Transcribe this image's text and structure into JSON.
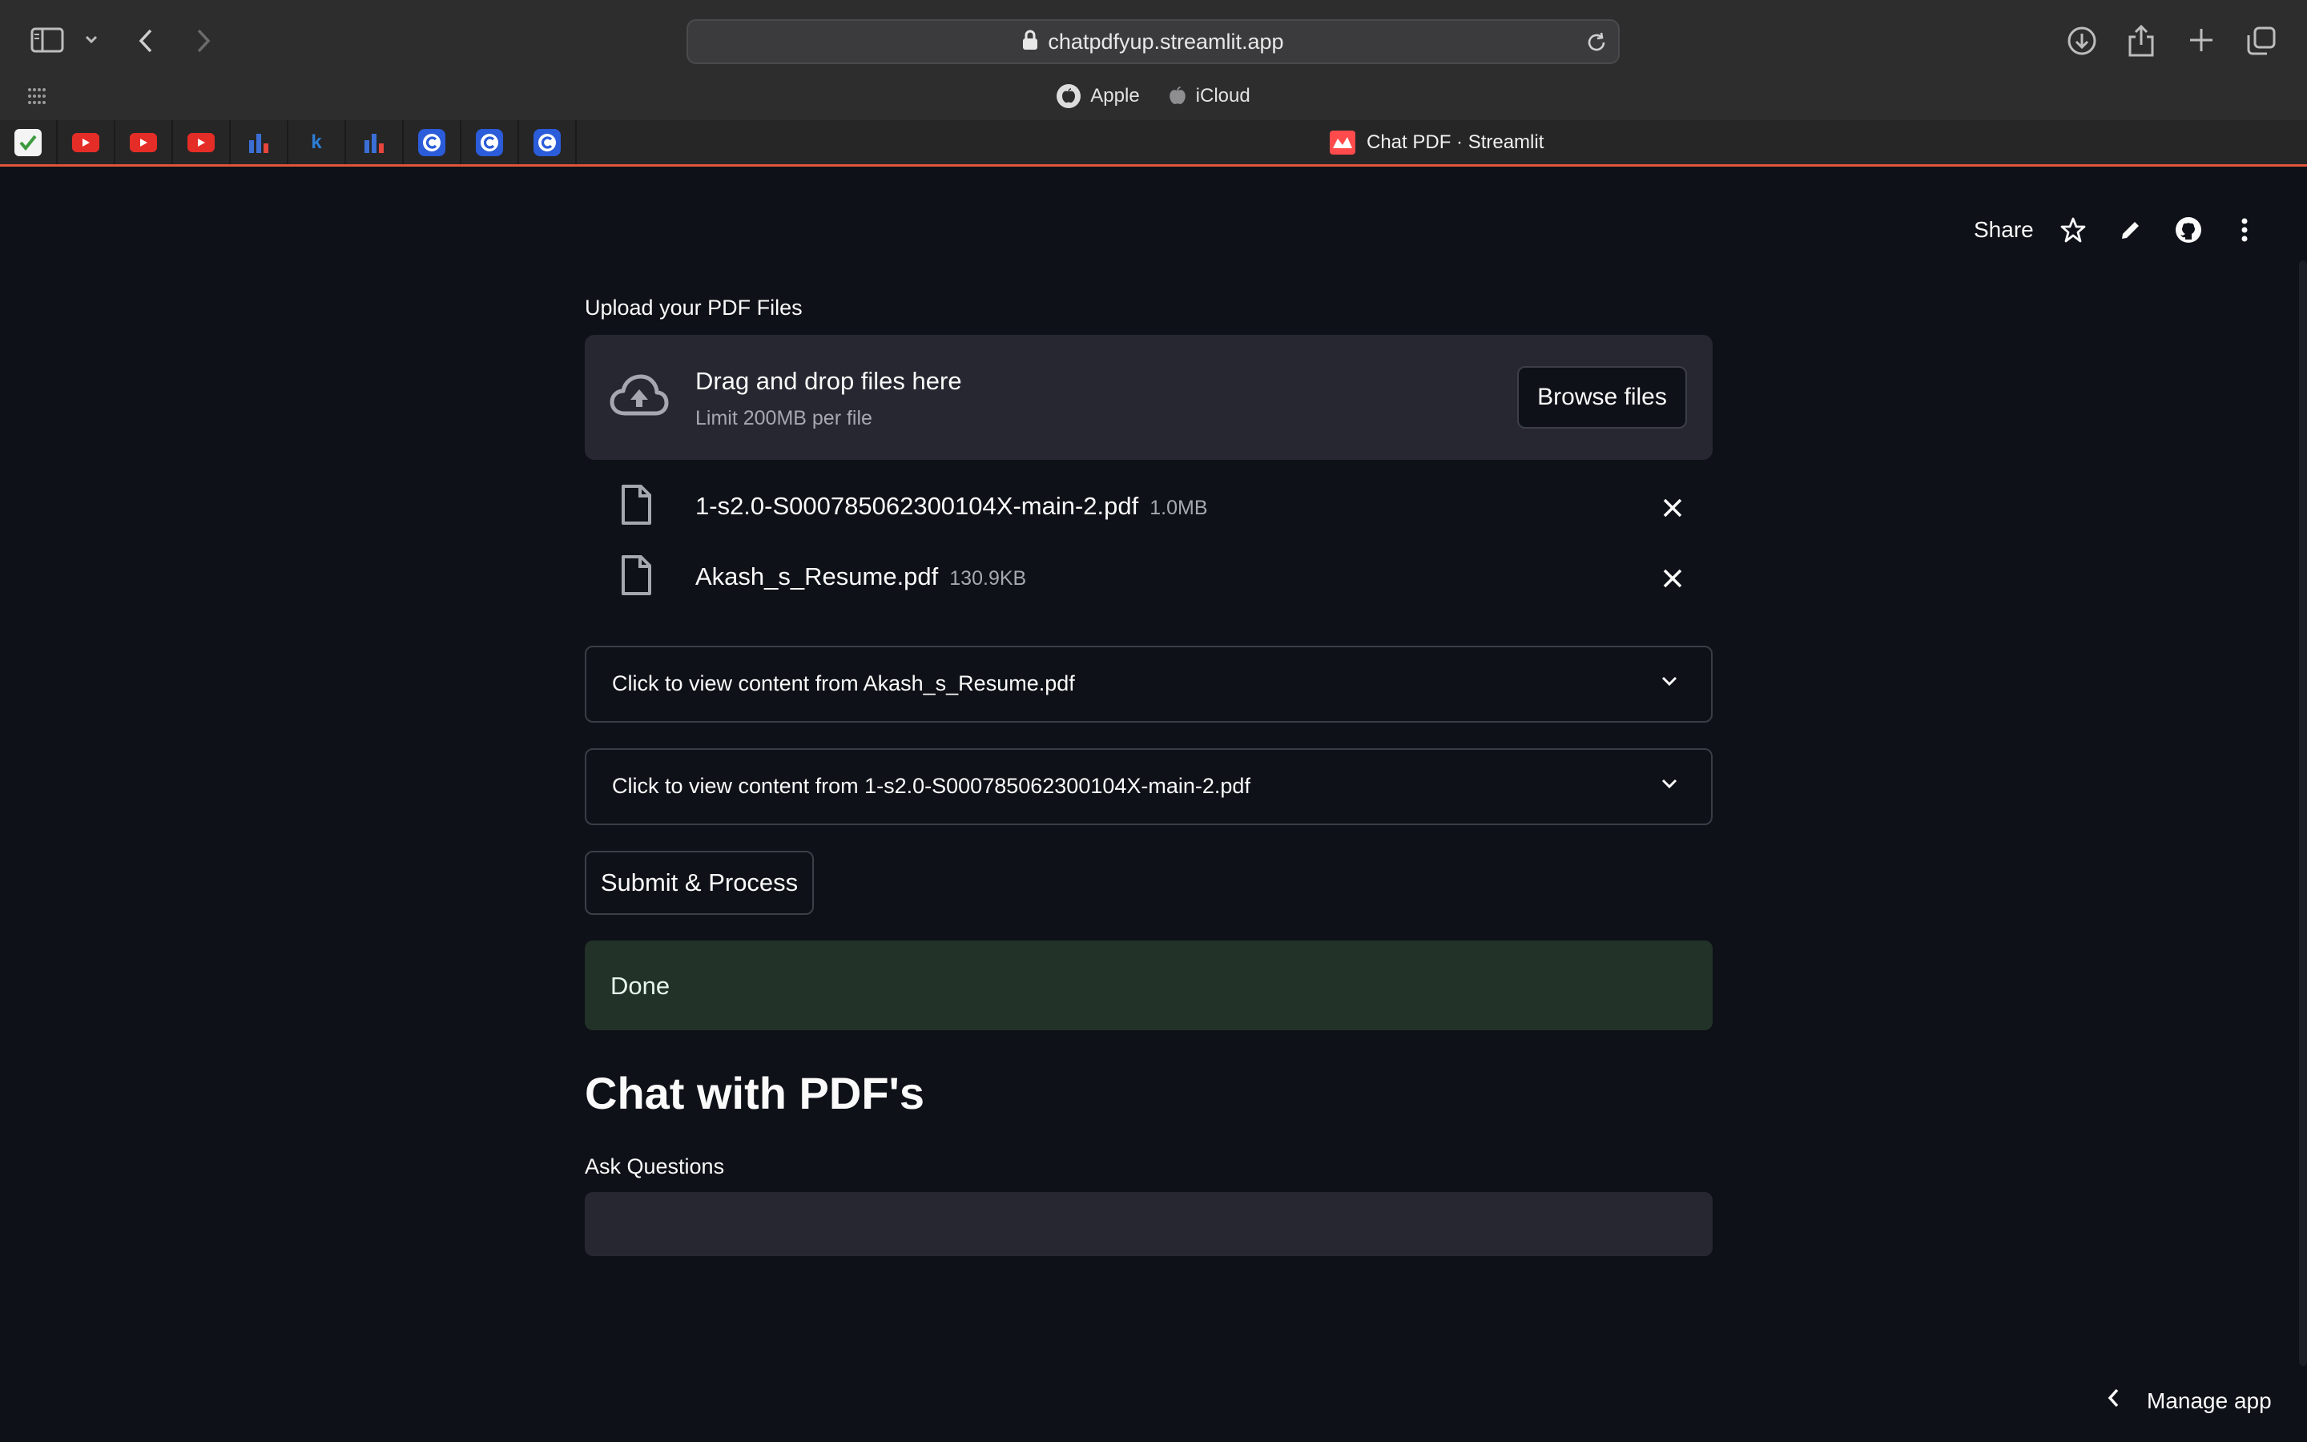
{
  "browser": {
    "url": "chatpdfyup.streamlit.app",
    "favorites": [
      {
        "label": "Apple",
        "icon": "apple-icon"
      },
      {
        "label": "iCloud",
        "icon": "apple-icon"
      }
    ],
    "pinned_tabs": [
      {
        "icon": "checkmark-icon",
        "letter": "",
        "color": "#3c9a3c"
      },
      {
        "icon": "youtube-icon",
        "letter": "",
        "color": "#e52d27"
      },
      {
        "icon": "youtube-icon",
        "letter": "",
        "color": "#e52d27"
      },
      {
        "icon": "youtube-icon",
        "letter": "",
        "color": "#e52d27"
      },
      {
        "icon": "bar-chart-icon",
        "letter": "",
        "color": "#3b6fd6"
      },
      {
        "icon": "k-icon",
        "letter": "k",
        "color": "#2d7fd6"
      },
      {
        "icon": "bar-chart-icon",
        "letter": "",
        "color": "#3b6fd6"
      },
      {
        "icon": "c-icon",
        "letter": "C",
        "color": "#2b5cd9"
      },
      {
        "icon": "c-icon",
        "letter": "C",
        "color": "#2b5cd9"
      },
      {
        "icon": "c-icon",
        "letter": "C",
        "color": "#2b5cd9"
      }
    ],
    "active_tab_title": "Chat PDF · Streamlit"
  },
  "header": {
    "share_label": "Share"
  },
  "upload": {
    "label": "Upload your PDF Files",
    "drop_title": "Drag and drop files here",
    "drop_limit": "Limit 200MB per file",
    "browse_label": "Browse files",
    "files": [
      {
        "name": "1-s2.0-S000785062300104X-main-2.pdf",
        "size": "1.0MB"
      },
      {
        "name": "Akash_s_Resume.pdf",
        "size": "130.9KB"
      }
    ]
  },
  "expanders": [
    {
      "label": "Click to view content from Akash_s_Resume.pdf"
    },
    {
      "label": "Click to view content from 1-s2.0-S000785062300104X-main-2.pdf"
    }
  ],
  "submit_label": "Submit & Process",
  "status_message": "Done",
  "chat": {
    "title": "Chat with PDF's",
    "ask_label": "Ask Questions",
    "ask_value": ""
  },
  "footer": {
    "manage_label": "Manage app"
  },
  "colors": {
    "background": "#0e1117",
    "accent": "#ff4b4b",
    "success_bg": "#223229",
    "widget_bg": "#262730"
  }
}
